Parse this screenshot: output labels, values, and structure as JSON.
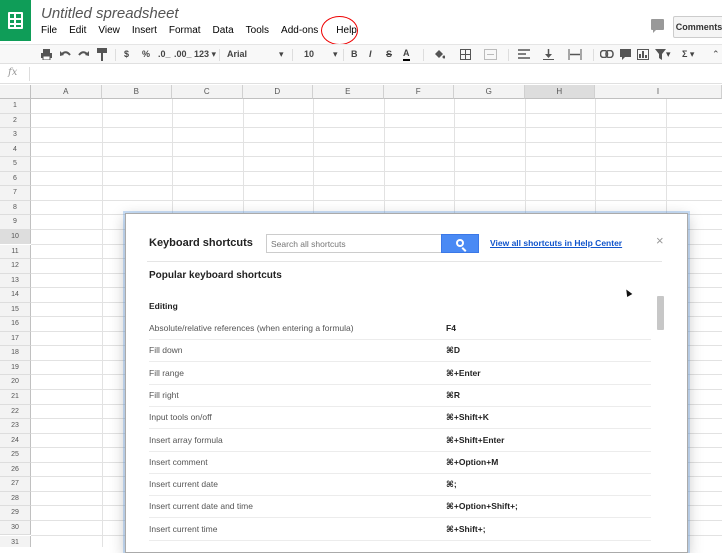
{
  "app": {
    "title": "Untitled spreadsheet",
    "menu": [
      "File",
      "Edit",
      "View",
      "Insert",
      "Format",
      "Data",
      "Tools",
      "Add-ons",
      "Help"
    ],
    "comments_label": "Comments"
  },
  "toolbar": {
    "currency": "$",
    "percent": "%",
    "dec_decrease": ".0_",
    "dec_increase": ".00_",
    "more_formats": "123 ▾",
    "font": "Arial",
    "font_size": "10",
    "bold": "B",
    "italic": "I",
    "strike": "S",
    "text_color": "A",
    "sigma": "Σ ▾"
  },
  "formula": {
    "fx": "fx"
  },
  "grid": {
    "columns": [
      "A",
      "B",
      "C",
      "D",
      "E",
      "F",
      "G",
      "H",
      "I"
    ],
    "selected_column": "H",
    "rows": [
      "1",
      "2",
      "3",
      "4",
      "5",
      "6",
      "7",
      "8",
      "9",
      "10",
      "11",
      "12",
      "13",
      "14",
      "15",
      "16",
      "17",
      "18",
      "19",
      "20",
      "21",
      "22",
      "23",
      "24",
      "25",
      "26",
      "27",
      "28",
      "29",
      "30",
      "31"
    ],
    "selected_row": "10"
  },
  "dialog": {
    "title": "Keyboard shortcuts",
    "search_placeholder": "Search all shortcuts",
    "help_link": "View all shortcuts in Help Center",
    "close": "×",
    "subtitle": "Popular keyboard shortcuts",
    "section": "Editing",
    "shortcuts": [
      {
        "name": "Absolute/relative references (when entering a formula)",
        "keys": "F4"
      },
      {
        "name": "Fill down",
        "keys": "⌘D"
      },
      {
        "name": "Fill range",
        "keys": "⌘+Enter"
      },
      {
        "name": "Fill right",
        "keys": "⌘R"
      },
      {
        "name": "Input tools on/off",
        "keys": "⌘+Shift+K"
      },
      {
        "name": "Insert array formula",
        "keys": "⌘+Shift+Enter"
      },
      {
        "name": "Insert comment",
        "keys": "⌘+Option+M"
      },
      {
        "name": "Insert current date",
        "keys": "⌘;"
      },
      {
        "name": "Insert current date and time",
        "keys": "⌘+Option+Shift+;"
      },
      {
        "name": "Insert current time",
        "keys": "⌘+Shift+;"
      }
    ]
  },
  "colors": {
    "brand": "#0f9d58",
    "accent": "#4a8af4",
    "link": "#1155cc",
    "annotation": "#ee0000"
  }
}
